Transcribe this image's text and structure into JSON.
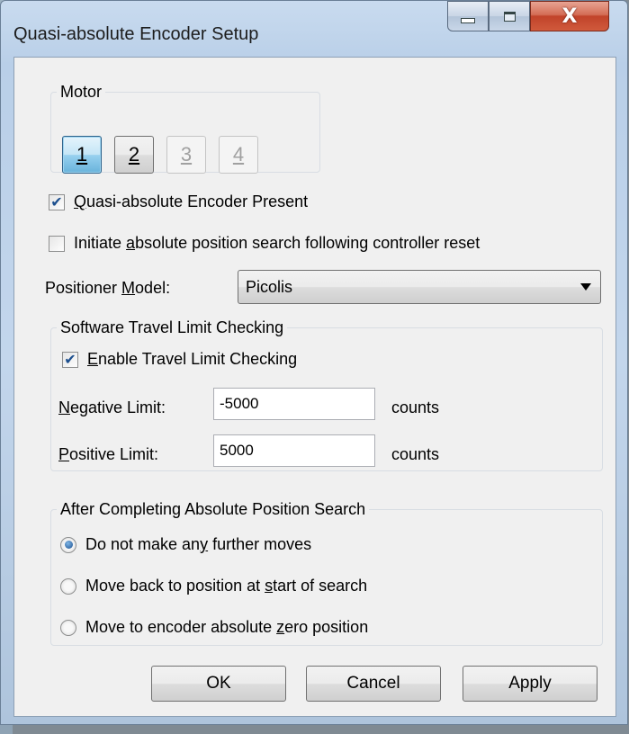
{
  "window": {
    "title": "Quasi-absolute Encoder Setup",
    "minimize_icon": "minimize-icon",
    "maximize_icon": "maximize-icon",
    "close_glyph": "X"
  },
  "motor": {
    "legend": "Motor",
    "buttons": [
      {
        "label": "1",
        "state": "active"
      },
      {
        "label": "2",
        "state": "normal"
      },
      {
        "label": "3",
        "state": "disabled"
      },
      {
        "label": "4",
        "state": "disabled"
      }
    ]
  },
  "encoder_present": {
    "label_hotkey": "Q",
    "label_rest": "uasi-absolute Encoder Present",
    "checked": true,
    "check_glyph": "✔"
  },
  "initiate_search": {
    "label_pre": "Initiate ",
    "label_hotkey": "a",
    "label_rest": "bsolute position search following controller reset",
    "checked": false
  },
  "positioner": {
    "label_pre": "Positioner ",
    "label_hotkey": "M",
    "label_rest": "odel:",
    "value": "Picolis"
  },
  "travel": {
    "legend": "Software Travel Limit Checking",
    "enable": {
      "label_hotkey": "E",
      "label_rest": "nable Travel Limit Checking",
      "checked": true,
      "check_glyph": "✔"
    },
    "negative": {
      "label_hotkey": "N",
      "label_rest": "egative Limit:",
      "value": "-5000",
      "unit": "counts"
    },
    "positive": {
      "label_hotkey": "P",
      "label_rest": "ositive Limit:",
      "value": "5000",
      "unit": "counts"
    }
  },
  "after": {
    "legend": "After Completing Absolute Position Search",
    "options": [
      {
        "pre": "Do not make an",
        "hotkey": "y",
        "post": " further moves",
        "selected": true
      },
      {
        "pre": "Move back to position at ",
        "hotkey": "s",
        "post": "tart of search",
        "selected": false
      },
      {
        "pre": "Move to encoder absolute ",
        "hotkey": "z",
        "post": "ero position",
        "selected": false
      }
    ]
  },
  "buttons": {
    "ok": "OK",
    "cancel": "Cancel",
    "apply": "Apply"
  },
  "colors": {
    "accent": "#68b3db",
    "close": "#c1432a",
    "client_bg": "#f0f0f0"
  }
}
